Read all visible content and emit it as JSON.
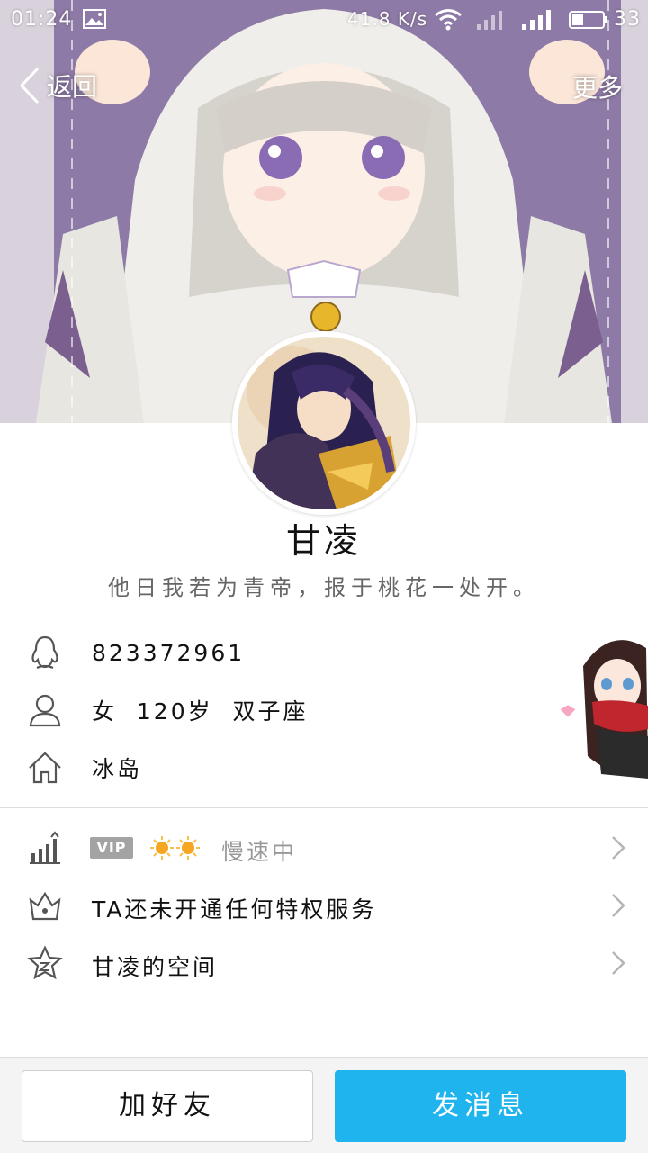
{
  "status_bar": {
    "time": "01:24",
    "net_speed": "41.8 K/s",
    "battery": "33",
    "icons": [
      "image-icon",
      "wifi-icon",
      "signal-icon",
      "signal-icon",
      "battery-icon"
    ]
  },
  "nav": {
    "back_label": "返回",
    "more_label": "更多"
  },
  "profile": {
    "nickname": "甘凌",
    "signature": "他日我若为青帝，报于桃花一处开。",
    "qq_number": "823372961",
    "gender_age_sign": "女  120岁  双子座",
    "location": "冰岛"
  },
  "list": {
    "vip_badge": "VIP",
    "vip_status": "慢速中",
    "privilege_text": "TA还未开通任何特权服务",
    "space_text": "甘凌的空间"
  },
  "actions": {
    "add_friend": "加好友",
    "send_message": "发消息"
  },
  "colors": {
    "primary_button": "#1fb4ee",
    "cover_purple": "#8c78a4",
    "vip_badge": "#a3a3a3"
  }
}
